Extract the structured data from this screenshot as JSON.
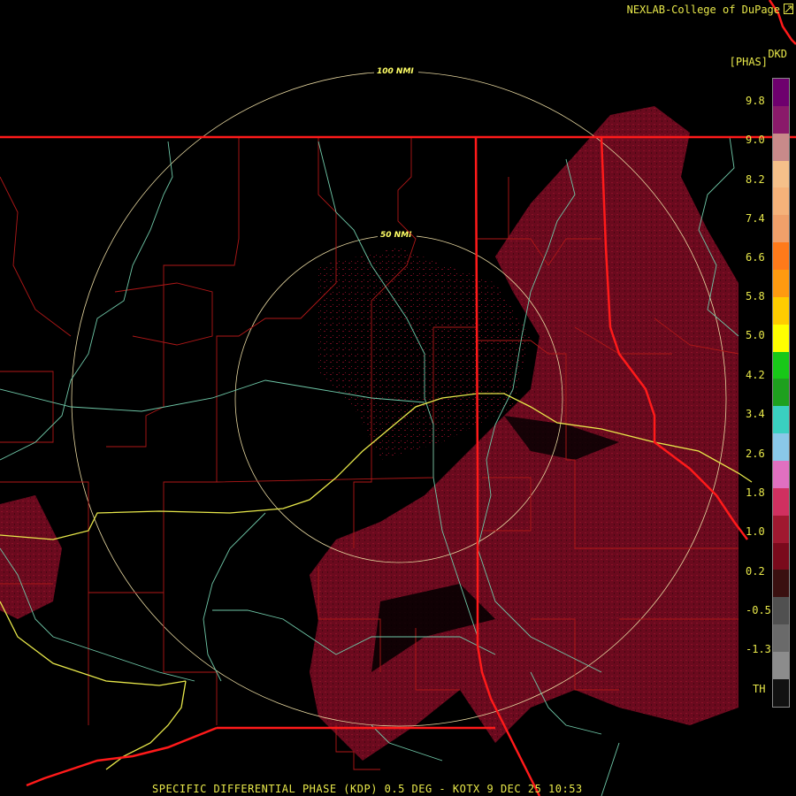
{
  "credit": "NEXLAB-College of DuPage",
  "product_code": "DKD",
  "units": "[PHAS]",
  "scale": {
    "labels": [
      "9.8",
      "9.0",
      "8.2",
      "7.4",
      "6.6",
      "5.8",
      "5.0",
      "4.2",
      "3.4",
      "2.6",
      "1.8",
      "1.0",
      "0.2",
      "-0.5",
      "-1.3",
      "TH"
    ],
    "colors": [
      "#6e006e",
      "#8a1a6a",
      "#c88a8a",
      "#f5c08a",
      "#f5b27a",
      "#f0a06a",
      "#ff7a1a",
      "#ff9a10",
      "#ffcc00",
      "#ffff00",
      "#18c818",
      "#1ea01e",
      "#3ad0c0",
      "#8ac8e8",
      "#e070c0",
      "#d03060",
      "#a01830",
      "#7a0a1c",
      "#3a1010",
      "#505050",
      "#6a6a6a",
      "#8c8c8c",
      "#111111"
    ]
  },
  "rings": {
    "inner_label": "50 NMI",
    "outer_label": "100 NMI"
  },
  "footer": "SPECIFIC DIFFERENTIAL PHASE (KDP) 0.5 DEG - KOTX 9 DEC 25 10:53"
}
